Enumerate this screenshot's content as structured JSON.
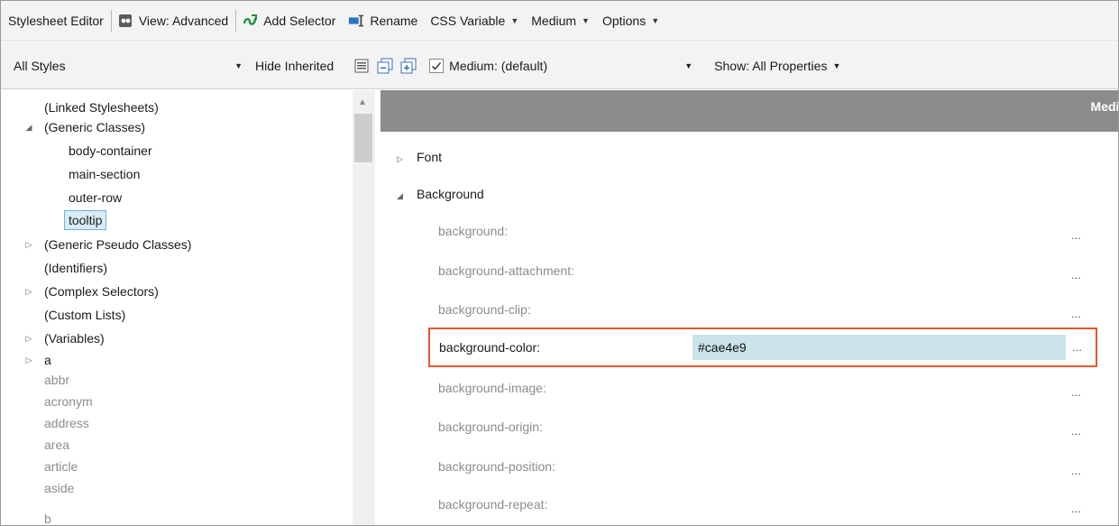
{
  "toolbar": {
    "title": "Stylesheet Editor",
    "view_label": "View: Advanced",
    "add_selector_label": "Add Selector",
    "rename_label": "Rename",
    "css_variable_label": "CSS Variable",
    "medium_label": "Medium",
    "options_label": "Options"
  },
  "filterbar": {
    "styles_dropdown_value": "All Styles",
    "hide_inherited_label": "Hide Inherited",
    "medium_checkbox_label": "Medium: (default)",
    "show_label": "Show: All Properties"
  },
  "tree": {
    "items": [
      {
        "label": "(Linked Stylesheets)",
        "toggle": ""
      },
      {
        "label": "(Generic Classes)",
        "toggle": "◢"
      },
      {
        "label": "body-container",
        "toggle": ""
      },
      {
        "label": "main-section",
        "toggle": ""
      },
      {
        "label": "outer-row",
        "toggle": ""
      },
      {
        "label": "tooltip",
        "toggle": ""
      },
      {
        "label": "(Generic Pseudo Classes)",
        "toggle": "▷"
      },
      {
        "label": "(Identifiers)",
        "toggle": ""
      },
      {
        "label": "(Complex Selectors)",
        "toggle": "▷"
      },
      {
        "label": "(Custom Lists)",
        "toggle": ""
      },
      {
        "label": "(Variables)",
        "toggle": "▷"
      },
      {
        "label": "a",
        "toggle": "▷"
      },
      {
        "label": "abbr",
        "toggle": ""
      },
      {
        "label": "acronym",
        "toggle": ""
      },
      {
        "label": "address",
        "toggle": ""
      },
      {
        "label": "area",
        "toggle": ""
      },
      {
        "label": "article",
        "toggle": ""
      },
      {
        "label": "aside",
        "toggle": ""
      },
      {
        "label": "b",
        "toggle": ""
      }
    ]
  },
  "properties": {
    "header_label": "Mediu",
    "categories": [
      {
        "label": "Font",
        "toggle": "▷"
      },
      {
        "label": "Background",
        "toggle": "◢"
      }
    ],
    "items": [
      {
        "name": "background:",
        "value": "",
        "more": "..."
      },
      {
        "name": "background-attachment:",
        "value": "",
        "more": "..."
      },
      {
        "name": "background-clip:",
        "value": "",
        "more": "..."
      },
      {
        "name": "background-color:",
        "value": "#cae4e9",
        "more": "..."
      },
      {
        "name": "background-image:",
        "value": "",
        "more": "..."
      },
      {
        "name": "background-origin:",
        "value": "",
        "more": "..."
      },
      {
        "name": "background-position:",
        "value": "",
        "more": "..."
      },
      {
        "name": "background-repeat:",
        "value": "",
        "more": "..."
      }
    ]
  },
  "colors": {
    "highlight_border": "#e05a2b",
    "value_background": "#cae4e9",
    "selection_background": "#d9ecf7",
    "header_background": "#8c8c8c"
  }
}
